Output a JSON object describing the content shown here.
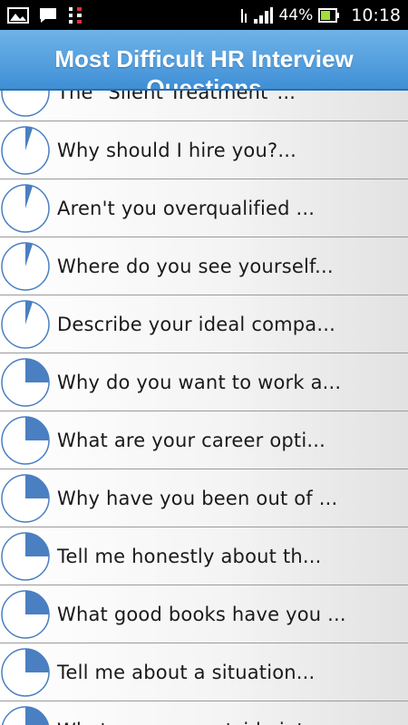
{
  "status_bar": {
    "battery_percent": "44%",
    "time": "10:18",
    "icons": [
      "gallery-icon",
      "chat-icon",
      "data-icon",
      "wifi-icon",
      "signal-icon",
      "battery-icon"
    ]
  },
  "header": {
    "title_line1": "Most Difficult HR Interview",
    "title_line2": "Questions",
    "colors": {
      "top": "#6fb3e8",
      "bottom": "#3f8fd6"
    }
  },
  "list": {
    "pie_color": "#4a7fc1",
    "items": [
      {
        "label": "The \"Silent Treatment\"...",
        "progress": 0.02
      },
      {
        "label": "Why should I hire you?...",
        "progress": 0.05
      },
      {
        "label": "Aren't you overqualified ...",
        "progress": 0.05
      },
      {
        "label": "Where do you see yourself...",
        "progress": 0.05
      },
      {
        "label": "Describe your ideal compa...",
        "progress": 0.05
      },
      {
        "label": "Why do you want to work a...",
        "progress": 0.25
      },
      {
        "label": "What are your career opti...",
        "progress": 0.25
      },
      {
        "label": "Why have you been out of ...",
        "progress": 0.25
      },
      {
        "label": "Tell me honestly about th...",
        "progress": 0.25
      },
      {
        "label": "What good books have you ...",
        "progress": 0.25
      },
      {
        "label": "Tell me about a situation...",
        "progress": 0.25
      },
      {
        "label": "What are your outside int...",
        "progress": 0.25
      }
    ]
  }
}
